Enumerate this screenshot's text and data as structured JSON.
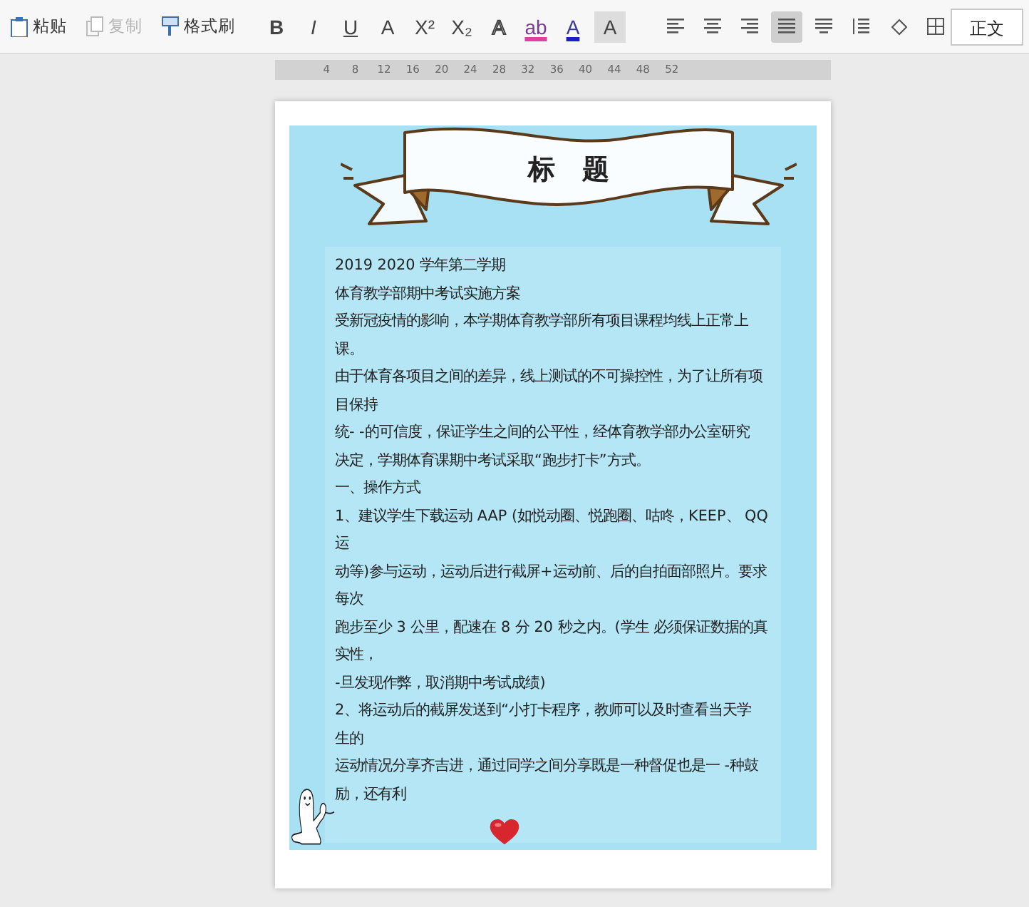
{
  "toolbar": {
    "clipboard": [
      {
        "kind": "paste",
        "label": "粘贴",
        "disabled": false
      },
      {
        "kind": "copy",
        "label": "复制",
        "disabled": true
      },
      {
        "kind": "format-painter",
        "label": "格式刷",
        "disabled": false
      }
    ],
    "font_buttons": [
      {
        "kind": "bold",
        "label": "B"
      },
      {
        "kind": "italic",
        "label": "I"
      },
      {
        "kind": "underline",
        "label": "U"
      },
      {
        "kind": "plain",
        "label": "A"
      },
      {
        "kind": "superscript",
        "label": "X²"
      },
      {
        "kind": "subscript",
        "label": "X₂"
      },
      {
        "kind": "outline",
        "label": "A"
      },
      {
        "kind": "highlight",
        "label": "ab"
      },
      {
        "kind": "fontcolor",
        "label": "A"
      },
      {
        "kind": "shade",
        "label": "A"
      }
    ],
    "paragraph_buttons": [
      {
        "kind": "align-left",
        "selected": false
      },
      {
        "kind": "align-center",
        "selected": false
      },
      {
        "kind": "align-right",
        "selected": false
      },
      {
        "kind": "justify",
        "selected": true
      },
      {
        "kind": "distribute",
        "selected": false
      },
      {
        "kind": "line-spacing",
        "selected": false
      },
      {
        "kind": "shading",
        "selected": false
      },
      {
        "kind": "borders",
        "selected": false
      }
    ],
    "style_label": "正文"
  },
  "ruler": {
    "ticks": [
      "4",
      "8",
      "12",
      "16",
      "20",
      "24",
      "28",
      "32",
      "36",
      "40",
      "44",
      "48",
      "52"
    ]
  },
  "document": {
    "title": "标　题",
    "lines": [
      "2019  2020 学年第二学期",
      "体育教学部期中考试实施方案",
      "受新冠疫情的影响，本学期体育教学部所有项目课程均线上正常上",
      "课。",
      "由于体育各项目之间的差异，线上测试的不可操控性，为了让所有项",
      "目保持",
      "统- -的可信度，保证学生之间的公平性，经体育教学部办公室研究",
      "决定，学期体育课期中考试采取“跑步打卡”方式。",
      "一、操作方式",
      "1、建议学生下载运动 AAP (如悦动圈、悦跑圈、咕咚，KEEP、 QQ",
      "运",
      "动等)参与运动，运动后进行截屏+运动前、后的自拍面部照片。要求",
      "每次",
      "跑步至少 3 公里，配速在 8 分 20 秒之内。(学生  必须保证数据的真",
      "实性，",
      "-旦发现作弊，取消期中考试成绩)",
      "2、将运动后的截屏发送到“小打卡程序，教师可以及时查看当天学",
      "生的",
      "运动情况分享齐吉进，通过同学之间分享既是一种督促也是一 -种鼓",
      "励，还有利"
    ]
  }
}
